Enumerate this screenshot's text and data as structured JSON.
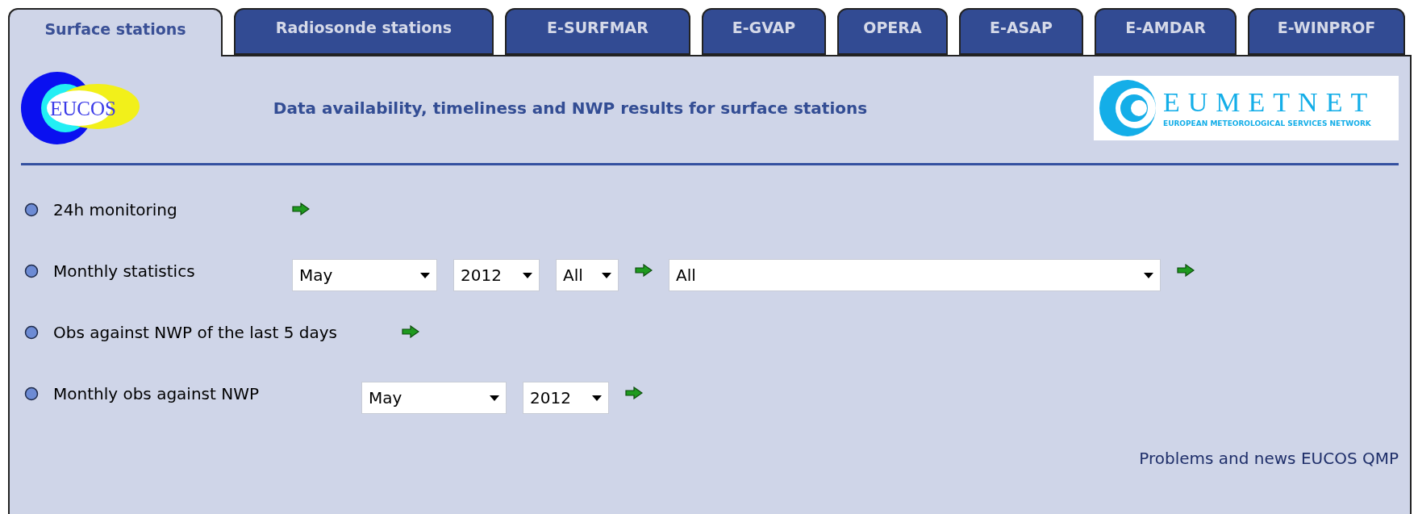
{
  "tabs": [
    {
      "label": "Surface stations",
      "selected": true
    },
    {
      "label": "Radiosonde stations",
      "selected": false
    },
    {
      "label": "E-SURFMAR",
      "selected": false
    },
    {
      "label": "E-GVAP",
      "selected": false
    },
    {
      "label": "OPERA",
      "selected": false
    },
    {
      "label": "E-ASAP",
      "selected": false
    },
    {
      "label": "E-AMDAR",
      "selected": false
    },
    {
      "label": "E-WINPROF",
      "selected": false
    }
  ],
  "header": {
    "left_logo": {
      "text": "EUCOS"
    },
    "title": "Data availability, timeliness and NWP results for surface stations",
    "right_logo": {
      "name": "EUMETNET",
      "tagline": "EUROPEAN METEOROLOGICAL SERVICES NETWORK"
    }
  },
  "rows": [
    {
      "label": "24h monitoring",
      "controls": [
        {
          "kind": "go"
        }
      ]
    },
    {
      "label": "Monthly statistics",
      "controls": [
        {
          "kind": "select",
          "value": "May"
        },
        {
          "kind": "select",
          "value": "2012"
        },
        {
          "kind": "select",
          "value": "All"
        },
        {
          "kind": "go"
        },
        {
          "kind": "select",
          "value": "All"
        },
        {
          "kind": "go"
        }
      ]
    },
    {
      "label": "Obs against NWP of the last 5 days",
      "controls": [
        {
          "kind": "go"
        }
      ]
    },
    {
      "label": "Monthly obs against NWP",
      "controls": [
        {
          "kind": "select",
          "value": "May"
        },
        {
          "kind": "select",
          "value": "2012"
        },
        {
          "kind": "go"
        }
      ]
    }
  ],
  "footer_link": "Problems and news EUCOS QMP"
}
